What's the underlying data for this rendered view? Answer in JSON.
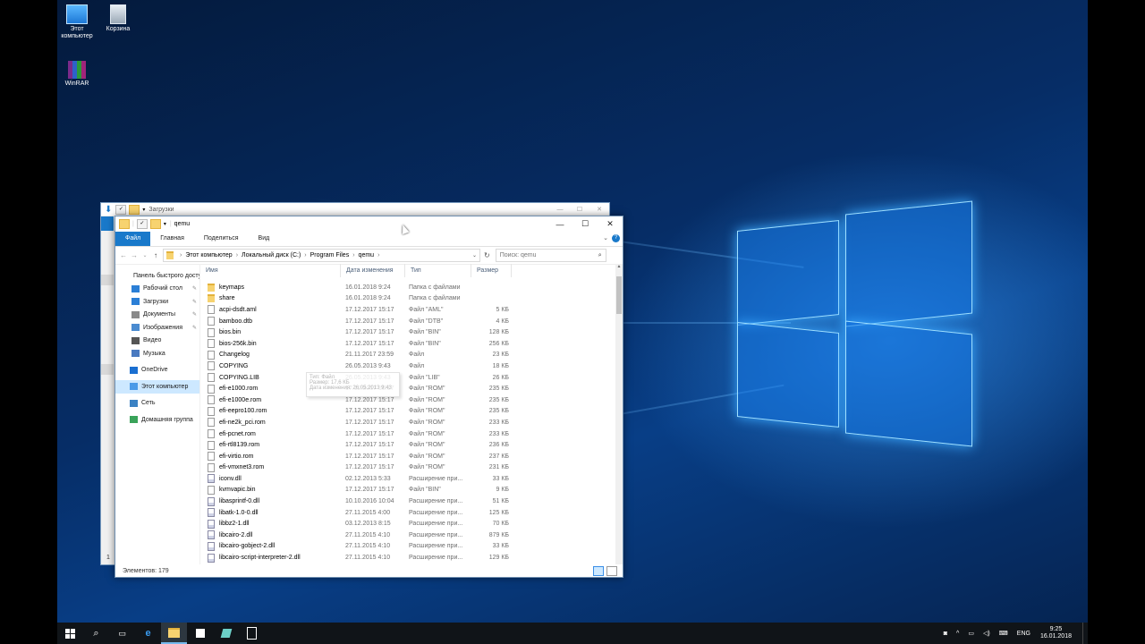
{
  "desktop": {
    "icons": [
      {
        "label_line1": "Этот",
        "label_line2": "компьютер"
      },
      {
        "label_line1": "Корзина",
        "label_line2": ""
      },
      {
        "label_line1": "WinRAR",
        "label_line2": ""
      }
    ]
  },
  "back_window": {
    "title": "Загрузки",
    "status_prefix": "1"
  },
  "window": {
    "title": "qemu",
    "tabs": [
      "Файл",
      "Главная",
      "Поделиться",
      "Вид"
    ],
    "breadcrumb": [
      "Этот компьютер",
      "Локальный диск (C:)",
      "Program Files",
      "qemu"
    ],
    "search_placeholder": "Поиск: qemu",
    "columns": [
      "Имя",
      "Дата изменения",
      "Тип",
      "Размер"
    ],
    "status": "Элементов: 179",
    "tooltip": [
      "Тип: Файл",
      "Размер: 17,6 КБ",
      "Дата изменения: 26.05.2013 9:43"
    ]
  },
  "sidebar": {
    "items": [
      {
        "label": "Панель быстрого доступа",
        "icon": "star-icon",
        "pinned": false
      },
      {
        "label": "Рабочий стол",
        "icon": "desktop-icon",
        "pinned": true
      },
      {
        "label": "Загрузки",
        "icon": "download-icon",
        "pinned": true
      },
      {
        "label": "Документы",
        "icon": "documents-icon",
        "pinned": true
      },
      {
        "label": "Изображения",
        "icon": "pictures-icon",
        "pinned": true
      },
      {
        "label": "Видео",
        "icon": "video-icon",
        "pinned": false
      },
      {
        "label": "Музыка",
        "icon": "music-icon",
        "pinned": false
      },
      {
        "label": "OneDrive",
        "icon": "cloud-icon",
        "pinned": false
      },
      {
        "label": "Этот компьютер",
        "icon": "computer-icon",
        "pinned": false
      },
      {
        "label": "Сеть",
        "icon": "network-icon",
        "pinned": false
      },
      {
        "label": "Домашняя группа",
        "icon": "homegroup-icon",
        "pinned": false
      }
    ]
  },
  "files": [
    {
      "name": "keymaps",
      "date": "16.01.2018 9:24",
      "type": "Папка с файлами",
      "size": "",
      "kind": "folder"
    },
    {
      "name": "share",
      "date": "16.01.2018 9:24",
      "type": "Папка с файлами",
      "size": "",
      "kind": "folder"
    },
    {
      "name": "acpi-dsdt.aml",
      "date": "17.12.2017 15:17",
      "type": "Файл \"AML\"",
      "size": "5 КБ",
      "kind": "file"
    },
    {
      "name": "bamboo.dtb",
      "date": "17.12.2017 15:17",
      "type": "Файл \"DTB\"",
      "size": "4 КБ",
      "kind": "file"
    },
    {
      "name": "bios.bin",
      "date": "17.12.2017 15:17",
      "type": "Файл \"BIN\"",
      "size": "128 КБ",
      "kind": "file"
    },
    {
      "name": "bios-256k.bin",
      "date": "17.12.2017 15:17",
      "type": "Файл \"BIN\"",
      "size": "256 КБ",
      "kind": "file"
    },
    {
      "name": "Changelog",
      "date": "21.11.2017 23:59",
      "type": "Файл",
      "size": "23 КБ",
      "kind": "file"
    },
    {
      "name": "COPYING",
      "date": "26.05.2013 9:43",
      "type": "Файл",
      "size": "18 КБ",
      "kind": "file"
    },
    {
      "name": "COPYING.LIB",
      "date": "26.05.2013 9:43",
      "type": "Файл \"LIB\"",
      "size": "26 КБ",
      "kind": "file"
    },
    {
      "name": "efi-e1000.rom",
      "date": "17.12.2017 15:17",
      "type": "Файл \"ROM\"",
      "size": "235 КБ",
      "kind": "file"
    },
    {
      "name": "efi-e1000e.rom",
      "date": "17.12.2017 15:17",
      "type": "Файл \"ROM\"",
      "size": "235 КБ",
      "kind": "file"
    },
    {
      "name": "efi-eepro100.rom",
      "date": "17.12.2017 15:17",
      "type": "Файл \"ROM\"",
      "size": "235 КБ",
      "kind": "file"
    },
    {
      "name": "efi-ne2k_pci.rom",
      "date": "17.12.2017 15:17",
      "type": "Файл \"ROM\"",
      "size": "233 КБ",
      "kind": "file"
    },
    {
      "name": "efi-pcnet.rom",
      "date": "17.12.2017 15:17",
      "type": "Файл \"ROM\"",
      "size": "233 КБ",
      "kind": "file"
    },
    {
      "name": "efi-rtl8139.rom",
      "date": "17.12.2017 15:17",
      "type": "Файл \"ROM\"",
      "size": "236 КБ",
      "kind": "file"
    },
    {
      "name": "efi-virtio.rom",
      "date": "17.12.2017 15:17",
      "type": "Файл \"ROM\"",
      "size": "237 КБ",
      "kind": "file"
    },
    {
      "name": "efi-vmxnet3.rom",
      "date": "17.12.2017 15:17",
      "type": "Файл \"ROM\"",
      "size": "231 КБ",
      "kind": "file"
    },
    {
      "name": "iconv.dll",
      "date": "02.12.2013 5:33",
      "type": "Расширение при...",
      "size": "33 КБ",
      "kind": "dll"
    },
    {
      "name": "kvmvapic.bin",
      "date": "17.12.2017 15:17",
      "type": "Файл \"BIN\"",
      "size": "9 КБ",
      "kind": "file"
    },
    {
      "name": "libasprintf-0.dll",
      "date": "10.10.2016 10:04",
      "type": "Расширение при...",
      "size": "51 КБ",
      "kind": "dll"
    },
    {
      "name": "libatk-1.0-0.dll",
      "date": "27.11.2015 4:00",
      "type": "Расширение при...",
      "size": "125 КБ",
      "kind": "dll"
    },
    {
      "name": "libbz2-1.dll",
      "date": "03.12.2013 8:15",
      "type": "Расширение при...",
      "size": "70 КБ",
      "kind": "dll"
    },
    {
      "name": "libcairo-2.dll",
      "date": "27.11.2015 4:10",
      "type": "Расширение при...",
      "size": "879 КБ",
      "kind": "dll"
    },
    {
      "name": "libcairo-gobject-2.dll",
      "date": "27.11.2015 4:10",
      "type": "Расширение при...",
      "size": "33 КБ",
      "kind": "dll"
    },
    {
      "name": "libcairo-script-interpreter-2.dll",
      "date": "27.11.2015 4:10",
      "type": "Расширение при...",
      "size": "129 КБ",
      "kind": "dll"
    }
  ],
  "taskbar": {
    "lang": "ENG",
    "time": "9:25",
    "date": "16.01.2018"
  },
  "colors": {
    "accent": "#1979ca",
    "selection": "#cde8ff",
    "taskbar": "#101418"
  }
}
